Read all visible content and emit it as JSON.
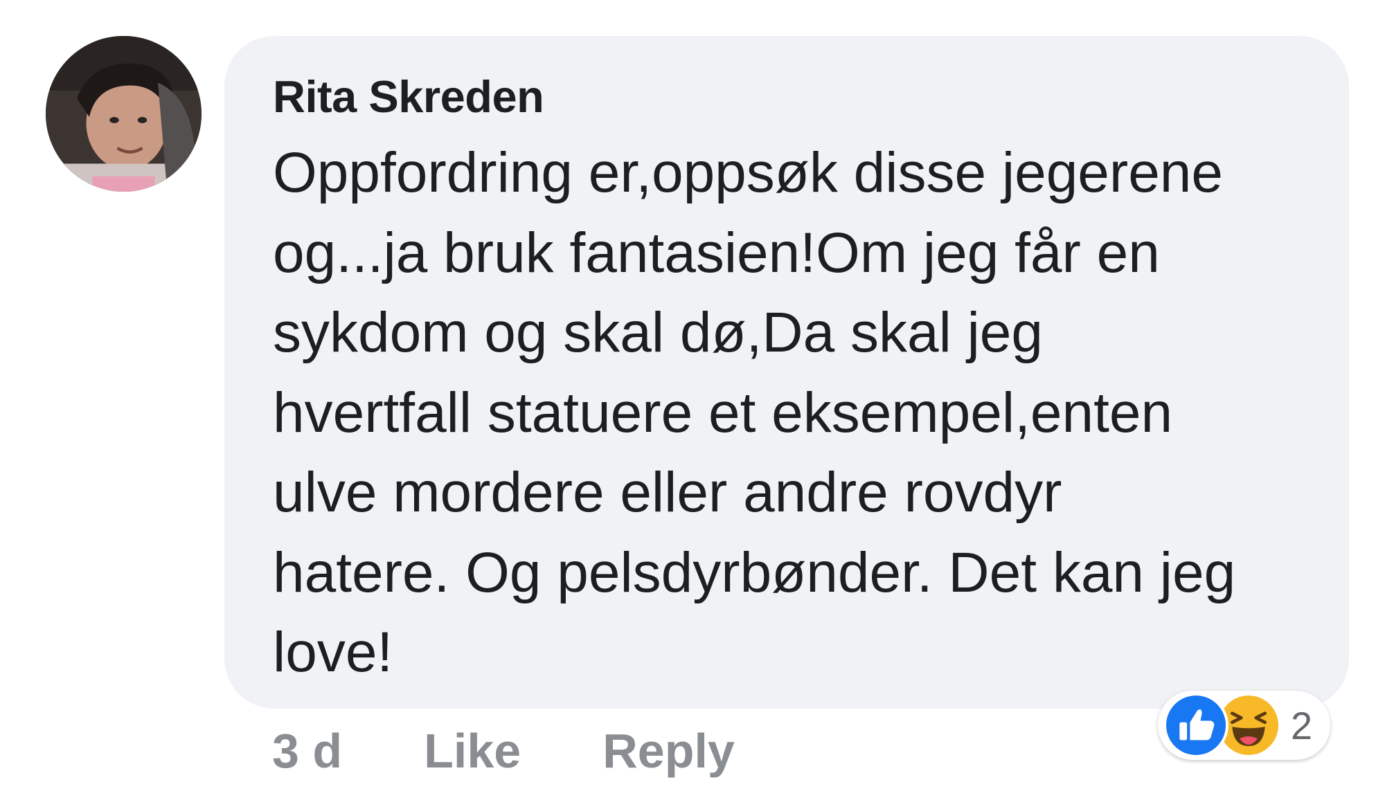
{
  "comment": {
    "author": "Rita Skreden",
    "text": "Oppfordring er,oppsøk disse jegerene\nog...ja bruk fantasien!Om jeg får en\nsykdom og skal dø,Da skal jeg\nhvertfall statuere et eksempel,enten\nulve mordere eller andre rovdyr\nhatere. Og pelsdyrbønder. Det kan jeg\nlove!",
    "timestamp": "3 d",
    "like_label": "Like",
    "reply_label": "Reply"
  },
  "reactions": {
    "icons": [
      "like-reaction-icon",
      "haha-reaction-icon"
    ],
    "count": "2"
  },
  "colors": {
    "bubble_bg": "#f0f2f5",
    "text": "#1c1e21",
    "action_text": "#8a8d91",
    "like_blue": "#1877f2",
    "haha_yellow": "#f7b928"
  }
}
